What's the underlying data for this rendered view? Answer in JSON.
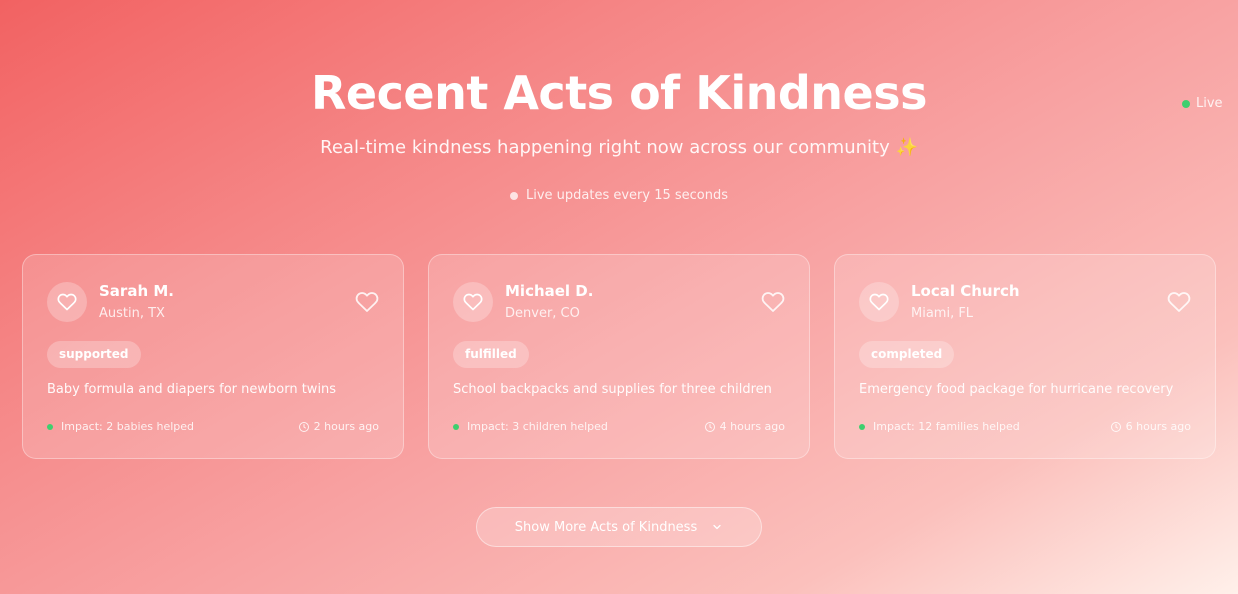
{
  "header": {
    "title": "Recent Acts of Kindness",
    "subtitle": "Real-time kindness happening right now across our community ✨",
    "update_note": "Live updates every 15 seconds",
    "live_label": "Live"
  },
  "cards": [
    {
      "name": "Sarah M.",
      "location": "Austin, TX",
      "status": "supported",
      "description": "Baby formula and diapers for newborn twins",
      "impact": "Impact: 2 babies helped",
      "time": "2 hours ago"
    },
    {
      "name": "Michael D.",
      "location": "Denver, CO",
      "status": "fulfilled",
      "description": "School backpacks and supplies for three children",
      "impact": "Impact: 3 children helped",
      "time": "4 hours ago"
    },
    {
      "name": "Local Church",
      "location": "Miami, FL",
      "status": "completed",
      "description": "Emergency food package for hurricane recovery",
      "impact": "Impact: 12 families helped",
      "time": "6 hours ago"
    }
  ],
  "show_more_label": "Show More Acts of Kindness",
  "icons": {
    "avatar": "heart-icon",
    "like": "heart-outline-icon",
    "time": "clock-icon",
    "show_more": "chevron-down-icon"
  },
  "colors": {
    "live_dot": "#3ecf6e",
    "gradient_start": "#f26262",
    "gradient_end": "#fff0ea"
  }
}
